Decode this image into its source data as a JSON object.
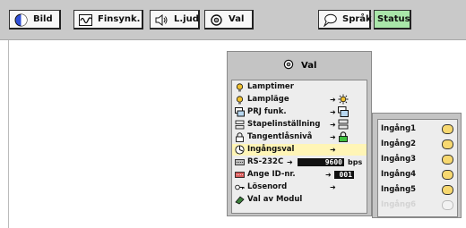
{
  "toolbar": {
    "bild": "Bild",
    "finsynk": "Finsynk.",
    "ljud": "L.jud",
    "val": "Val",
    "sprak": "Språk",
    "status": "Status"
  },
  "panel": {
    "title": "Val",
    "items": [
      {
        "label": "Lamptimer"
      },
      {
        "label": "Lampläge",
        "arrow": "➜"
      },
      {
        "label": "PRJ funk.",
        "arrow": "➜"
      },
      {
        "label": "Stapelinställning",
        "arrow": "➜"
      },
      {
        "label": "Tangentlåsnivå",
        "arrow": "➜"
      },
      {
        "label": "Ingångsval",
        "arrow": "➜"
      },
      {
        "label": "RS-232C",
        "arrow": "➜",
        "value": "9600",
        "unit": "bps"
      },
      {
        "label": "Ange ID-nr.",
        "arrow": "➜",
        "value": "001"
      },
      {
        "label": "Lösenord",
        "arrow": "➜"
      },
      {
        "label": "Val av Modul"
      }
    ]
  },
  "submenu": {
    "items": [
      "Ingång1",
      "Ingång2",
      "Ingång3",
      "Ingång4",
      "Ingång5",
      "Ingång6"
    ]
  },
  "colors": {
    "selected_row": "#fff5b6",
    "status_button": "#a9e6a9",
    "radio_fill": "#f7d870"
  }
}
